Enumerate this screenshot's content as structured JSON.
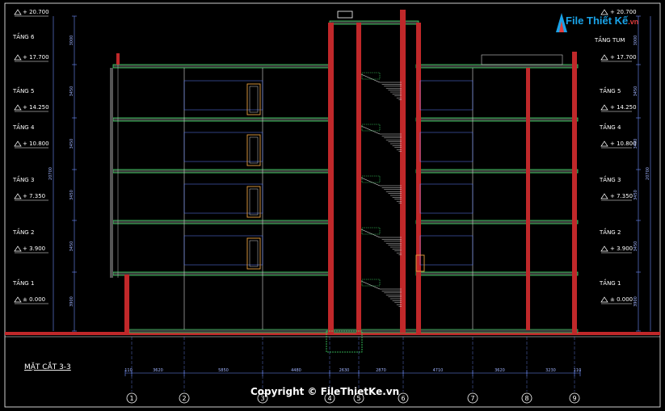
{
  "logo": {
    "text": "File Thiết Kế",
    "suffix": ".vn"
  },
  "section_title": "MẶT CẮT 3-3",
  "copyright": "Copyright © FileThietKe.vn",
  "levels_left": [
    {
      "name": "TẦNG 6",
      "elev": "+ 20.700"
    },
    {
      "name": "",
      "elev": "+ 17.700"
    },
    {
      "name": "TẦNG 5",
      "elev": "+ 14.250"
    },
    {
      "name": "TẦNG 4",
      "elev": "+ 10.800"
    },
    {
      "name": "TẦNG 3",
      "elev": "+ 7.350"
    },
    {
      "name": "TẦNG 2",
      "elev": "+ 3.900"
    },
    {
      "name": "TẦNG 1",
      "elev": "± 0.000"
    }
  ],
  "levels_right": [
    {
      "name": "TẦNG TUM",
      "elev": "+ 17.700"
    },
    {
      "name": "TẦNG 5",
      "elev": "+ 14.250"
    },
    {
      "name": "TẦNG 4",
      "elev": "+ 10.800"
    },
    {
      "name": "TẦNG 3",
      "elev": "+ 7.350"
    },
    {
      "name": "TẦNG 2",
      "elev": "+ 3.900"
    },
    {
      "name": "TẦNG 1",
      "elev": "± 0.000"
    }
  ],
  "right_top_elev": "+ 20.700",
  "left_dims": [
    "3000",
    "3450",
    "3450",
    "3450",
    "3450",
    "3900"
  ],
  "right_dims": [
    "3000",
    "3450",
    "3450",
    "3450",
    "3450",
    "3900"
  ],
  "total_dim": "20700",
  "bottom_dims": [
    "110",
    "3620",
    "5850",
    "4480",
    "2630",
    "2870",
    "4710",
    "3620",
    "3230",
    "110"
  ],
  "axes": [
    "1",
    "2",
    "3",
    "4",
    "5",
    "6",
    "7",
    "8",
    "9"
  ]
}
